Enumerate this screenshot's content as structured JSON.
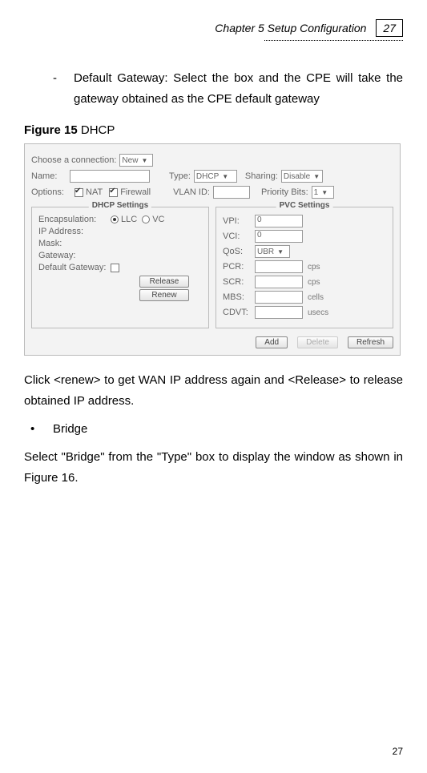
{
  "header": {
    "chapter": "Chapter 5 Setup Configuration",
    "page": "27"
  },
  "bullet": {
    "dash": "-",
    "text": "Default Gateway: Select the box and the CPE will take the gateway obtained as the CPE default gateway"
  },
  "figure": {
    "label_bold": "Figure 15",
    "label_rest": " DHCP"
  },
  "panel": {
    "choose_label": "Choose a connection:",
    "choose_value": "New",
    "name_label": "Name:",
    "name_value": "",
    "type_label": "Type:",
    "type_value": "DHCP",
    "sharing_label": "Sharing:",
    "sharing_value": "Disable",
    "options_label": "Options:",
    "nat_label": "NAT",
    "firewall_label": "Firewall",
    "vlan_label": "VLAN ID:",
    "vlan_value": "",
    "priority_label": "Priority Bits:",
    "priority_value": "1",
    "dhcp_legend": "DHCP Settings",
    "encap_label": "Encapsulation:",
    "encap_llc": "LLC",
    "encap_vc": "VC",
    "ip_label": "IP Address:",
    "mask_label": "Mask:",
    "gateway_label": "Gateway:",
    "defgw_label": "Default Gateway:",
    "btn_release": "Release",
    "btn_renew": "Renew",
    "pvc_legend": "PVC Settings",
    "vpi_label": "VPI:",
    "vpi_value": "0",
    "vci_label": "VCI:",
    "vci_value": "0",
    "qos_label": "QoS:",
    "qos_value": "UBR",
    "pcr_label": "PCR:",
    "pcr_unit": "cps",
    "scr_label": "SCR:",
    "scr_unit": "cps",
    "mbs_label": "MBS:",
    "mbs_unit": "cells",
    "cdvt_label": "CDVT:",
    "cdvt_unit": "usecs",
    "btn_add": "Add",
    "btn_delete": "Delete",
    "btn_refresh": "Refresh"
  },
  "para1": "Click <renew> to get WAN IP address again and <Release> to release obtained IP address.",
  "bullet2": {
    "dot": "•",
    "text": "Bridge"
  },
  "para2": "Select \"Bridge\" from the \"Type\" box to display the window as shown in Figure 16.",
  "footer_page": "27",
  "chart_data": null
}
